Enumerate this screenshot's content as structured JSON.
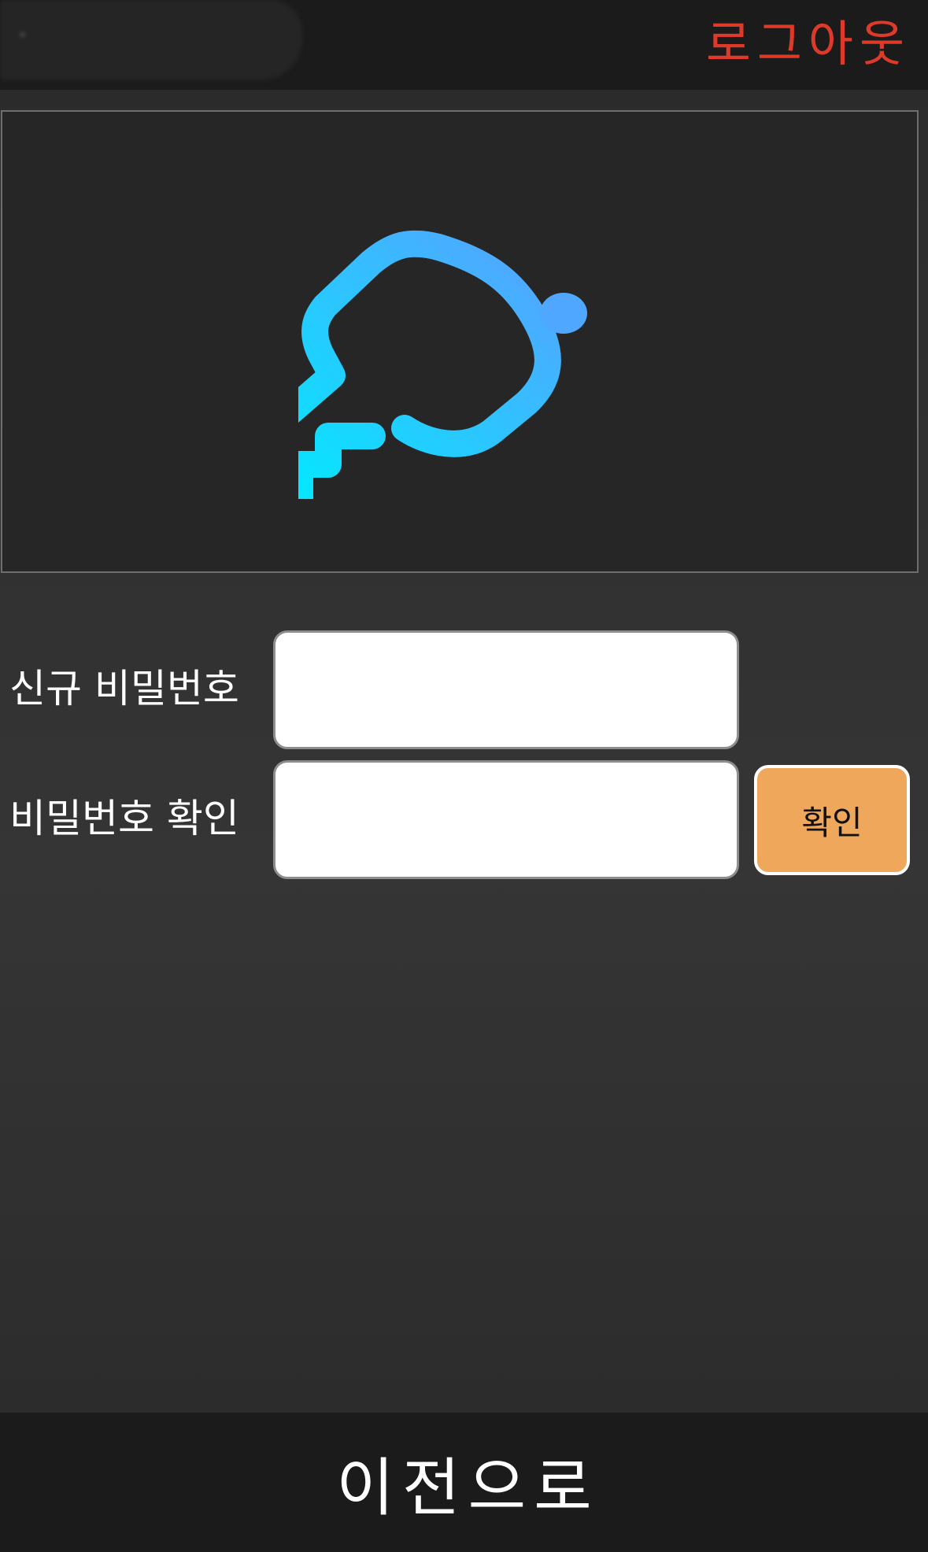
{
  "header": {
    "logout_label": "로그아웃"
  },
  "hero": {
    "icon": "key-icon",
    "gradient_start": "#00ebff",
    "gradient_end": "#56a2ff"
  },
  "form": {
    "new_password_label": "신규 비밀번호",
    "confirm_password_label": "비밀번호 확인",
    "new_password_value": "",
    "confirm_password_value": "",
    "confirm_button_label": "확인"
  },
  "footer": {
    "back_label": "이전으로"
  },
  "colors": {
    "logout": "#de3a2a",
    "confirm_button": "#efa75b",
    "bar_background": "#1b1b1b"
  }
}
